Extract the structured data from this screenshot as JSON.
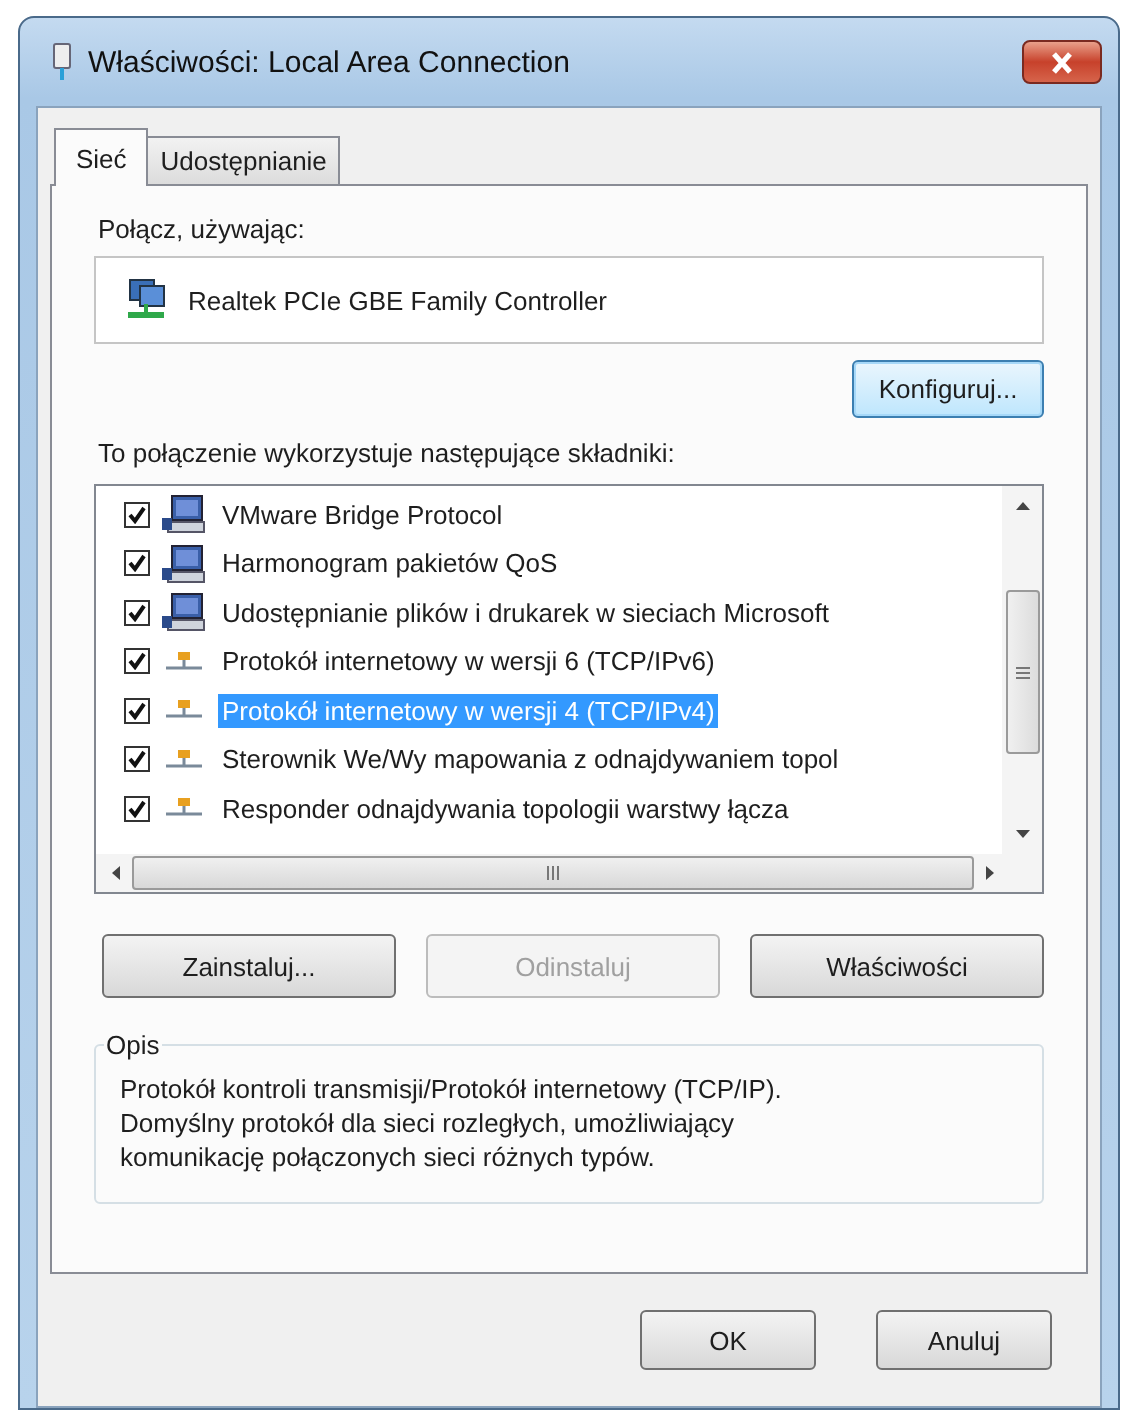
{
  "window": {
    "title": "Właściwości: Local Area Connection"
  },
  "tabs": [
    {
      "label": "Sieć",
      "selected": true
    },
    {
      "label": "Udostępnianie",
      "selected": false
    }
  ],
  "connect_using": {
    "label": "Połącz, używając:",
    "adapter": "Realtek PCIe GBE Family Controller",
    "configure_button": "Konfiguruj..."
  },
  "components": {
    "label": "To połączenie wykorzystuje następujące składniki:",
    "items": [
      {
        "kind": "service",
        "name": "VMware Bridge Protocol",
        "checked": true,
        "selected": false
      },
      {
        "kind": "service",
        "name": "Harmonogram pakietów QoS",
        "checked": true,
        "selected": false
      },
      {
        "kind": "service",
        "name": "Udostępnianie plików i drukarek w sieciach Microsoft",
        "checked": true,
        "selected": false
      },
      {
        "kind": "protocol",
        "name": "Protokół internetowy w wersji 6 (TCP/IPv6)",
        "checked": true,
        "selected": false
      },
      {
        "kind": "protocol",
        "name": "Protokół internetowy w wersji 4 (TCP/IPv4)",
        "checked": true,
        "selected": true
      },
      {
        "kind": "protocol",
        "name": "Sterownik We/Wy mapowania z odnajdywaniem topol",
        "checked": true,
        "selected": false
      },
      {
        "kind": "protocol",
        "name": "Responder odnajdywania topologii warstwy łącza",
        "checked": true,
        "selected": false
      }
    ]
  },
  "item_buttons": [
    {
      "label": "Zainstaluj...",
      "disabled": false
    },
    {
      "label": "Odinstaluj",
      "disabled": true
    },
    {
      "label": "Właściwości",
      "disabled": false
    }
  ],
  "description": {
    "title": "Opis",
    "text": "Protokół kontroli transmisji/Protokół internetowy (TCP/IP). Domyślny protokół dla sieci rozległych, umożliwiający komunikację połączonych sieci różnych typów."
  },
  "buttons": [
    "OK",
    "Anuluj"
  ]
}
